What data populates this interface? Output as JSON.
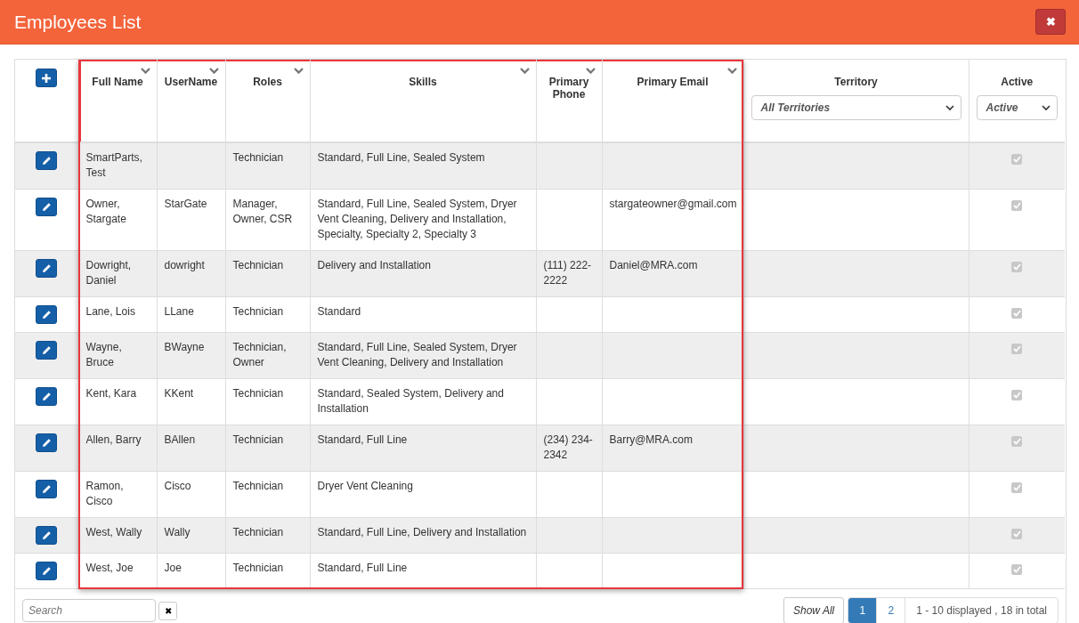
{
  "window": {
    "title": "Employees List",
    "close_label": "✖"
  },
  "table": {
    "columns": [
      {
        "kind": "sortable",
        "label": "Full Name",
        "highlighted": true
      },
      {
        "kind": "sortable",
        "label": "UserName",
        "highlighted": true
      },
      {
        "kind": "sortable",
        "label": "Roles",
        "highlighted": true
      },
      {
        "kind": "sortable",
        "label": "Skills",
        "highlighted": true
      },
      {
        "kind": "sortable",
        "label": "Primary Phone",
        "highlighted": true
      },
      {
        "kind": "sortable",
        "label": "Primary Email",
        "highlighted": true
      },
      {
        "kind": "filter",
        "label": "Territory",
        "highlighted": false,
        "filter": "All Territories"
      },
      {
        "kind": "filter",
        "label": "Active",
        "highlighted": false,
        "filter": "Active"
      }
    ],
    "rows": [
      {
        "cells": [
          "SmartParts, Test",
          "",
          "Technician",
          "Standard, Full Line, Sealed System",
          "",
          "",
          ""
        ],
        "active": true
      },
      {
        "cells": [
          "Owner, Stargate",
          "StarGate",
          "Manager, Owner, CSR",
          "Standard, Full Line, Sealed System, Dryer Vent Cleaning, Delivery and Installation, Specialty, Specialty 2, Specialty 3",
          "",
          "stargateowner@gmail.com",
          ""
        ],
        "active": true
      },
      {
        "cells": [
          "Dowright, Daniel",
          "dowright",
          "Technician",
          "Delivery and Installation",
          "(111) 222-2222",
          "Daniel@MRA.com",
          ""
        ],
        "active": true
      },
      {
        "cells": [
          "Lane, Lois",
          "LLane",
          "Technician",
          "Standard",
          "",
          "",
          ""
        ],
        "active": true
      },
      {
        "cells": [
          "Wayne, Bruce",
          "BWayne",
          "Technician, Owner",
          "Standard, Full Line, Sealed System, Dryer Vent Cleaning, Delivery and Installation",
          "",
          "",
          ""
        ],
        "active": true
      },
      {
        "cells": [
          "Kent, Kara",
          "KKent",
          "Technician",
          "Standard, Sealed System, Delivery and Installation",
          "",
          "",
          ""
        ],
        "active": true
      },
      {
        "cells": [
          "Allen, Barry",
          "BAllen",
          "Technician",
          "Standard, Full Line",
          "(234) 234-2342",
          "Barry@MRA.com",
          ""
        ],
        "active": true
      },
      {
        "cells": [
          "Ramon, Cisco",
          "Cisco",
          "Technician",
          "Dryer Vent Cleaning",
          "",
          "",
          ""
        ],
        "active": true
      },
      {
        "cells": [
          "West, Wally",
          "Wally",
          "Technician",
          "Standard, Full Line, Delivery and Installation",
          "",
          "",
          ""
        ],
        "active": true
      },
      {
        "cells": [
          "West, Joe",
          "Joe",
          "Technician",
          "Standard, Full Line",
          "",
          "",
          ""
        ],
        "active": true
      }
    ]
  },
  "footer": {
    "search": {
      "placeholder": "Search"
    },
    "clear_label": "✖",
    "show_all": "Show All",
    "pages": [
      {
        "label": "1",
        "selected": true
      },
      {
        "label": "2",
        "selected": false
      }
    ],
    "summary": "1 - 10 displayed , 18 in total"
  }
}
